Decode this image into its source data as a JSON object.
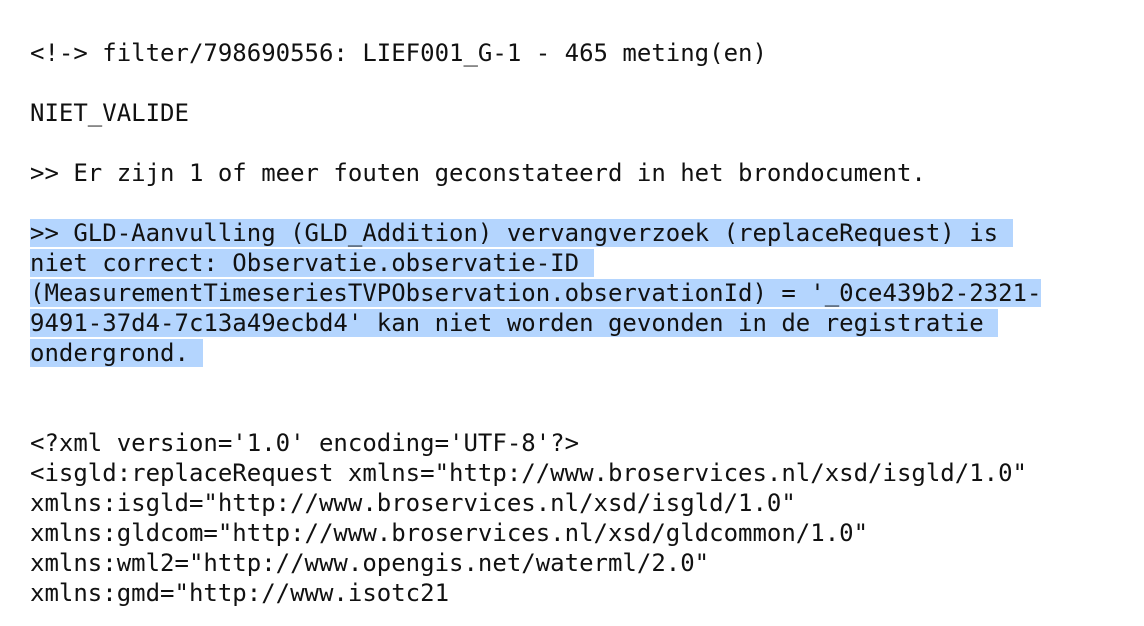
{
  "header_line": "<!-> filter/798690556: LIEF001_G-1 - 465 meting(en)",
  "status": "NIET_VALIDE",
  "error_summary": ">> Er zijn 1 of meer fouten geconstateerd in het brondocument.",
  "error_detail": [
    ">> GLD-Aanvulling (GLD_Addition) vervangverzoek (replaceRequest) is ",
    "niet correct: Observatie.observatie-ID ",
    "(MeasurementTimeseriesTVPObservation.observationId) = '_0ce439b2-2321-",
    "9491-37d4-7c13a49ecbd4' kan niet worden gevonden in de registratie ",
    "ondergrond. "
  ],
  "xml_lines": [
    "<?xml version='1.0' encoding='UTF-8'?>",
    "<isgld:replaceRequest xmlns=\"http://www.broservices.nl/xsd/isgld/1.0\"",
    "xmlns:isgld=\"http://www.broservices.nl/xsd/isgld/1.0\"",
    "xmlns:gldcom=\"http://www.broservices.nl/xsd/gldcommon/1.0\"",
    "xmlns:wml2=\"http://www.opengis.net/waterml/2.0\"",
    "xmlns:gmd=\"http://www.isotc21"
  ],
  "colors": {
    "text": "#111111",
    "selection": "#b4d5fe",
    "background": "#ffffff"
  }
}
